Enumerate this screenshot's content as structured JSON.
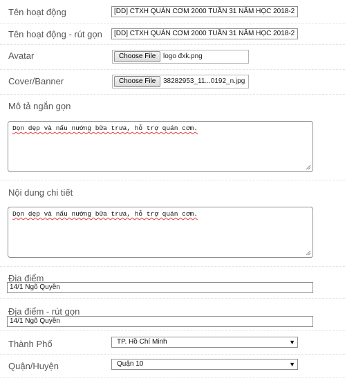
{
  "form": {
    "activity_name": {
      "label": "Tên hoạt động",
      "value": "[DD] CTXH QUÁN CƠM 2000 TUẦN 31 NĂM HỌC 2018-2"
    },
    "activity_short": {
      "label": "Tên hoạt động - rút gọn",
      "value": "[DD] CTXH QUÁN CƠM 2000 TUẦN 31 NĂM HỌC 2018-2"
    },
    "avatar": {
      "label": "Avatar",
      "button": "Choose File",
      "filename": "logo đxk.png"
    },
    "cover": {
      "label": "Cover/Banner",
      "button": "Choose File",
      "filename": "38282953_11...0192_n.jpg"
    },
    "short_desc": {
      "label": "Mô tả ngắn gọn",
      "value": "Dọn dẹp và nấu nướng bữa trưa, hỗ trợ quán cơm."
    },
    "detail": {
      "label": "Nội dung chi tiết",
      "value": "Dọn dẹp và nấu nướng bữa trưa, hỗ trợ quán cơm."
    },
    "location": {
      "label": "Địa điểm",
      "value": "14/1 Ngô Quyền"
    },
    "location_short": {
      "label": "Địa điểm - rút gọn",
      "value": "14/1 Ngô Quyền"
    },
    "city": {
      "label": "Thành Phố",
      "value": "TP. Hồ Chí Minh"
    },
    "district": {
      "label": "Quận/Huyện",
      "value": "Quận 10"
    }
  },
  "icons": {
    "dropdown": "chevron-down-icon",
    "resize": "resize-grip-icon"
  }
}
